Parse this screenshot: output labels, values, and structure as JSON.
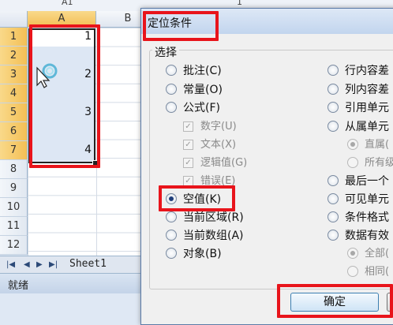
{
  "formula_bar": {
    "name_box": "A1",
    "formula": "1"
  },
  "sheet": {
    "columns": [
      "A",
      "B"
    ],
    "rows": [
      "1",
      "2",
      "3",
      "4",
      "5",
      "6",
      "7",
      "8",
      "9",
      "10",
      "11",
      "12"
    ],
    "cells": [
      {
        "row": 1,
        "value": "1"
      },
      {
        "row": 3,
        "value": "2"
      },
      {
        "row": 5,
        "value": "3"
      },
      {
        "row": 7,
        "value": "4"
      }
    ],
    "tab": "Sheet1",
    "tab_nav": [
      "|◀",
      "◀",
      "▶",
      "▶|"
    ]
  },
  "status_bar": {
    "text": "就绪"
  },
  "dialog": {
    "title": "定位条件",
    "group_label": "选择",
    "left_options": [
      {
        "label": "批注(C)",
        "selected": false
      },
      {
        "label": "常量(O)",
        "selected": false
      },
      {
        "label": "公式(F)",
        "selected": false
      },
      {
        "label": "数字(U)",
        "sub": true,
        "checked": true
      },
      {
        "label": "文本(X)",
        "sub": true,
        "checked": true
      },
      {
        "label": "逻辑值(G)",
        "sub": true,
        "checked": true
      },
      {
        "label": "错误(E)",
        "sub": true,
        "checked": true
      },
      {
        "label": "空值(K)",
        "selected": true
      },
      {
        "label": "当前区域(R)",
        "selected": false
      },
      {
        "label": "当前数组(A)",
        "selected": false
      },
      {
        "label": "对象(B)",
        "selected": false
      }
    ],
    "right_options": [
      {
        "label": "行内容差",
        "selected": false
      },
      {
        "label": "列内容差",
        "selected": false
      },
      {
        "label": "引用单元",
        "selected": false
      },
      {
        "label": "从属单元",
        "selected": false
      },
      {
        "label": "直属(",
        "sub": true,
        "selected": true
      },
      {
        "label": "所有级",
        "sub": true,
        "selected": false
      },
      {
        "label": "最后一个",
        "selected": false
      },
      {
        "label": "可见单元",
        "selected": false
      },
      {
        "label": "条件格式",
        "selected": false
      },
      {
        "label": "数据有效",
        "selected": false
      },
      {
        "label": "全部(",
        "sub": true,
        "selected": true
      },
      {
        "label": "相同(",
        "sub": true,
        "selected": false
      }
    ],
    "ok_label": "确定"
  },
  "colors": {
    "highlight": "#e8141b",
    "selection_header": "#f3bf55"
  }
}
